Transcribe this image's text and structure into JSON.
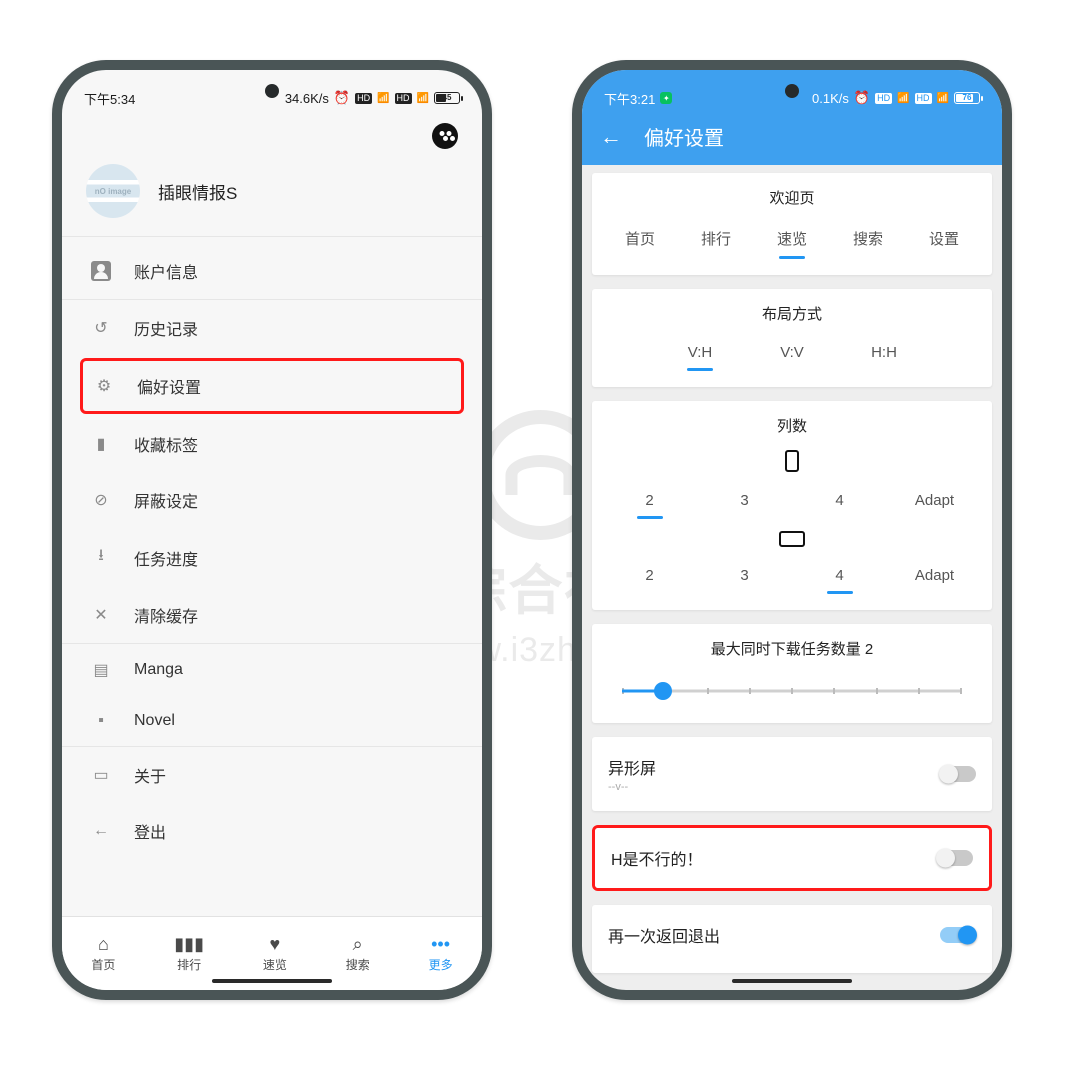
{
  "watermark": {
    "title": "i3综合社区",
    "url": "www.i3zh.com"
  },
  "left": {
    "status": {
      "time": "下午5:34",
      "speed": "34.6K/s",
      "battery_pct": 45,
      "battery_text": "45"
    },
    "profile": {
      "name": "插眼情报S",
      "avatar_text": "nO image"
    },
    "menu": {
      "account": "账户信息",
      "history": "历史记录",
      "preferences": "偏好设置",
      "bookmarks": "收藏标签",
      "block": "屏蔽设定",
      "tasks": "任务进度",
      "clear_cache": "清除缓存",
      "manga": "Manga",
      "novel": "Novel",
      "about": "关于",
      "logout": "登出"
    },
    "nav": {
      "home": "首页",
      "rank": "排行",
      "browse": "速览",
      "search": "搜索",
      "more": "更多"
    }
  },
  "right": {
    "status": {
      "time": "下午3:21",
      "speed": "0.1K/s",
      "battery_pct": 76,
      "battery_text": "76"
    },
    "header": {
      "title": "偏好设置"
    },
    "welcome": {
      "title": "欢迎页",
      "options": {
        "home": "首页",
        "rank": "排行",
        "browse": "速览",
        "search": "搜索",
        "settings": "设置"
      },
      "selected": "速览"
    },
    "layout": {
      "title": "布局方式",
      "options": {
        "vh": "V:H",
        "vv": "V:V",
        "hh": "H:H"
      },
      "selected": "V:H"
    },
    "columns": {
      "title": "列数",
      "options": {
        "c2": "2",
        "c3": "3",
        "c4": "4",
        "adapt": "Adapt"
      },
      "portrait_selected": "2",
      "landscape_selected": "4"
    },
    "download": {
      "title": "最大同时下载任务数量 2",
      "value_pct": 12
    },
    "toggles": {
      "notch": {
        "label": "异形屏",
        "sub": "--v--",
        "on": false
      },
      "h": {
        "label": "H是不行的！",
        "on": false
      },
      "back_exit": {
        "label": "再一次返回退出",
        "on": true
      }
    }
  }
}
